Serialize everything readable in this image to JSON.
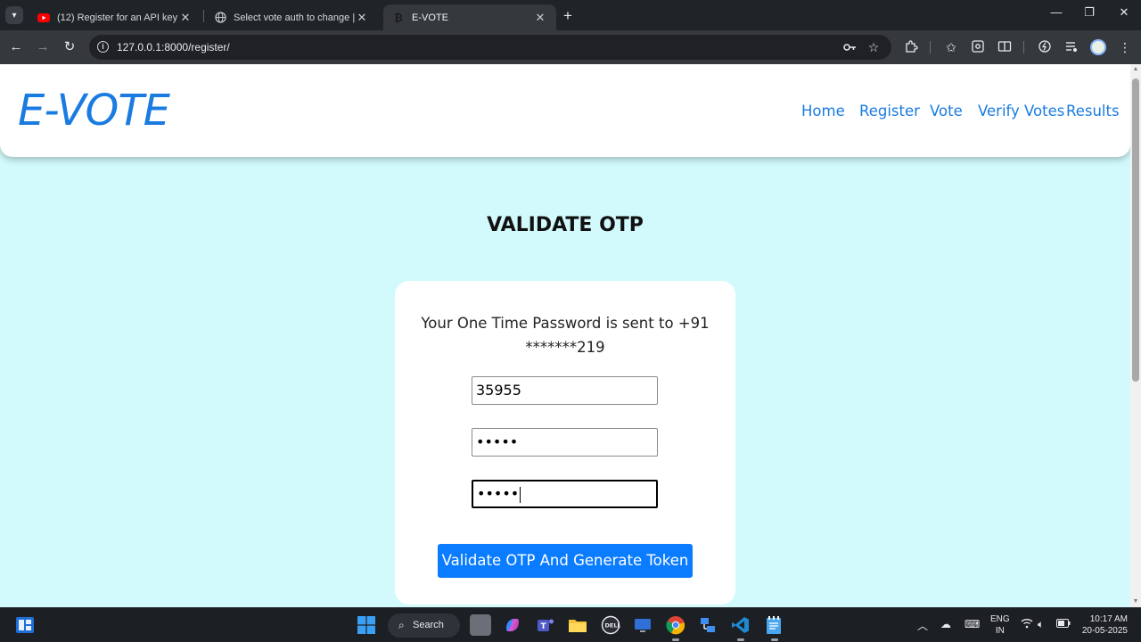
{
  "browser": {
    "tabs": [
      {
        "title": "(12) Register for an API key for",
        "favicon": "youtube-icon"
      },
      {
        "title": "Select vote auth to change | Dja",
        "favicon": "globe-icon"
      },
      {
        "title": "E-VOTE",
        "favicon": "bitcoin-icon"
      }
    ],
    "url": "127.0.0.1:8000/register/"
  },
  "site": {
    "brand": "E-VOTE",
    "nav": [
      "Home",
      "Register",
      "Vote",
      "Verify Votes",
      "Results"
    ],
    "brand_color": "#1a7be0",
    "background_color": "#d2fafc"
  },
  "main": {
    "title": "VALIDATE OTP",
    "otp_message": "Your One Time Password is sent to +91 *******219",
    "fields": {
      "otp_value": "35955",
      "password_mask": "•••••",
      "confirm_mask": "•••••"
    },
    "submit_label": "Validate OTP And Generate Token",
    "button_color": "#0a7cff"
  },
  "taskbar": {
    "search_label": "Search",
    "lang_line1": "ENG",
    "lang_line2": "IN",
    "time": "10:17 AM",
    "date": "20-05-2025"
  }
}
